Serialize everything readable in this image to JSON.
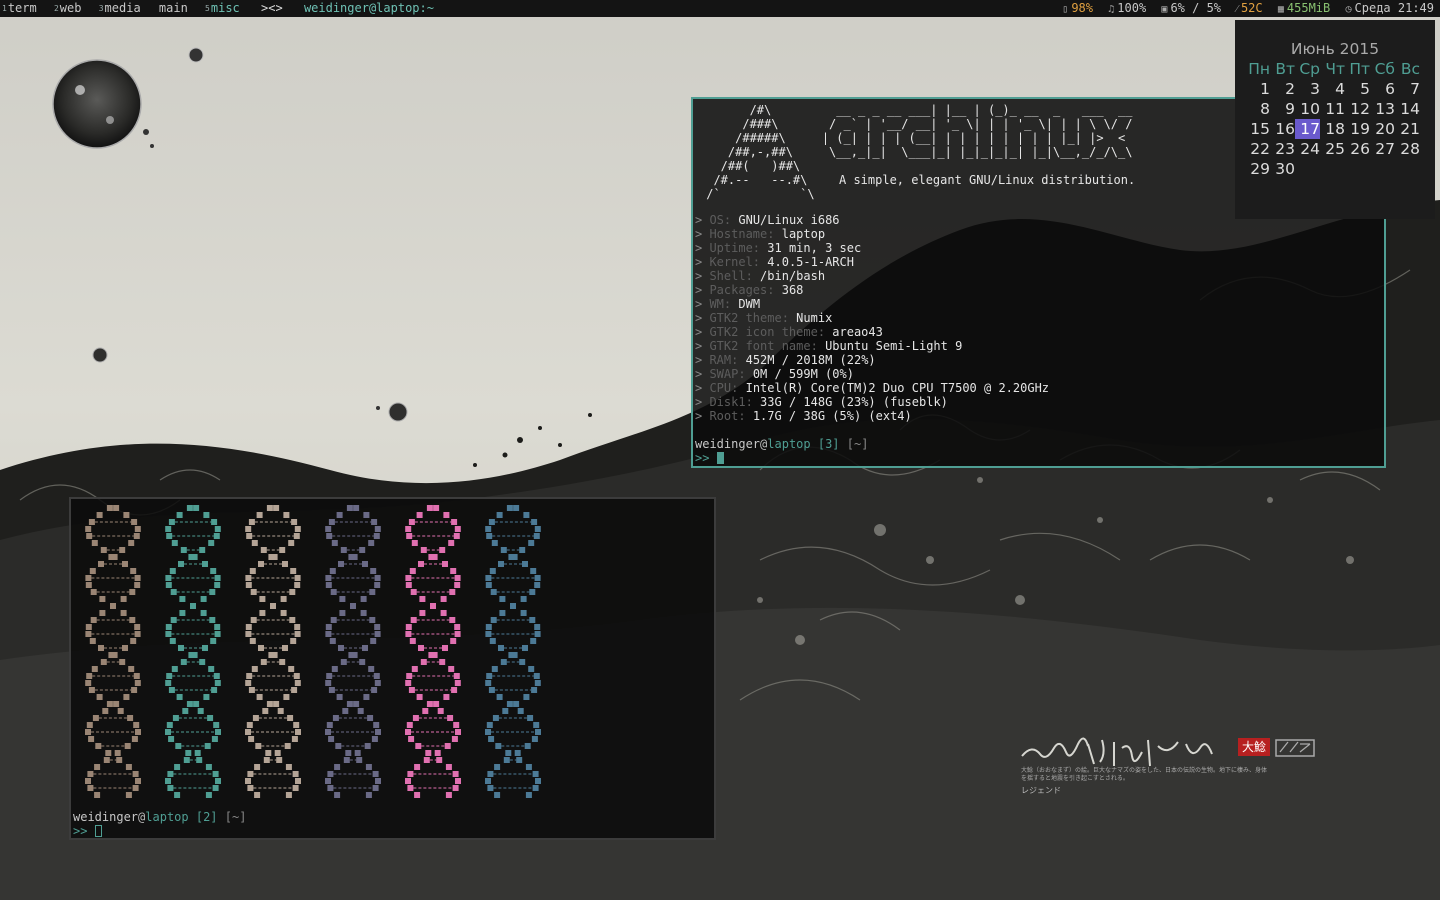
{
  "bar": {
    "tags": [
      {
        "sup": "1",
        "label": "term"
      },
      {
        "sup": "2",
        "label": "web"
      },
      {
        "sup": "3",
        "label": "media"
      },
      {
        "sup": "",
        "label": "main"
      },
      {
        "sup": "5",
        "label": "misc"
      }
    ],
    "layout_symbol": "><>",
    "window_title": "weidinger@laptop:~",
    "status": {
      "battery": "98%",
      "volume": "100%",
      "cpu": "6% / 5%",
      "temp": "52C",
      "mem": "455MiB",
      "datetime": "Среда 21:49"
    }
  },
  "calendar": {
    "title": "Июнь 2015",
    "weekdays": [
      "Пн",
      "Вт",
      "Ср",
      "Чт",
      "Пт",
      "Сб",
      "Вс"
    ],
    "weeks": [
      [
        "",
        "1",
        "2",
        "3",
        "4",
        "5",
        "6",
        "7"
      ],
      [
        "",
        "8",
        "9",
        "10",
        "11",
        "12",
        "13",
        "14"
      ],
      [
        "",
        "15",
        "16",
        "17",
        "18",
        "19",
        "20",
        "21"
      ],
      [
        "",
        "22",
        "23",
        "24",
        "25",
        "26",
        "27",
        "28"
      ],
      [
        "",
        "29",
        "30",
        "",
        "",
        "",
        "",
        ""
      ]
    ],
    "today": "17"
  },
  "term_top": {
    "ascii_logo": "       /#\\         __ _ _ __ ___| |__ | (_)_ __  _   ___  __\n      /###\\       / _` | '__/ __| '_ \\| | | '_ \\| | | \\ \\/ /\n     /#####\\     | (_| | | | (__| | | | | | | | | |_| |>  <\n    /##,-,##\\     \\__,_|_|  \\___|_| |_|_|_|_| |_|\\__,_/_/\\_\\\n   /##(   )##\\\n  /#.--   --.#\\\n /`           `\\",
    "tagline": "A simple, elegant GNU/Linux distribution.",
    "info": [
      {
        "key": "OS:",
        "value": "GNU/Linux i686"
      },
      {
        "key": "Hostname:",
        "value": "laptop"
      },
      {
        "key": "Uptime:",
        "value": "31 min, 3 sec"
      },
      {
        "key": "Kernel:",
        "value": "4.0.5-1-ARCH"
      },
      {
        "key": "Shell:",
        "value": "/bin/bash"
      },
      {
        "key": "Packages:",
        "value": "368"
      },
      {
        "key": "WM:",
        "value": "DWM"
      },
      {
        "key": "GTK2 theme:",
        "value": "Numix"
      },
      {
        "key": "GTK2 icon theme:",
        "value": "areao43"
      },
      {
        "key": "GTK2 font name:",
        "value": "Ubuntu Semi-Light 9"
      },
      {
        "key": "RAM:",
        "value": "452M / 2018M (22%)"
      },
      {
        "key": "SWAP:",
        "value": "0M / 599M (0%)"
      },
      {
        "key": "CPU:",
        "value": "Intel(R) Core(TM)2 Duo CPU T7500 @ 2.20GHz"
      },
      {
        "key": "Disk1:",
        "value": "33G / 148G (23%) (fuseblk)"
      },
      {
        "key": "Root:",
        "value": "1.7G / 38G (5%) (ext4)"
      }
    ],
    "prompt": {
      "user": "weidinger",
      "host": "laptop",
      "num": "[3]",
      "dir": "[~]"
    },
    "cursor_prefix": ">> "
  },
  "term_bottom": {
    "helix_colors": [
      "#9a8574",
      "#4f9e93",
      "#b4a496",
      "#6a6a86",
      "#e070b0",
      "#4c7a96"
    ],
    "prompt": {
      "user": "weidinger",
      "host": "laptop",
      "num": "[2]",
      "dir": "[~]"
    },
    "cursor_prefix": ">> "
  },
  "signature": {
    "stamp": "大鯰",
    "caption": "大鯰（おおなまず）の絵。巨大なナマズの姿をした、日本の伝説の生物。地下に棲み、身体を揺すると地震を引き起こすとされる。",
    "legend": "レジェンド"
  }
}
